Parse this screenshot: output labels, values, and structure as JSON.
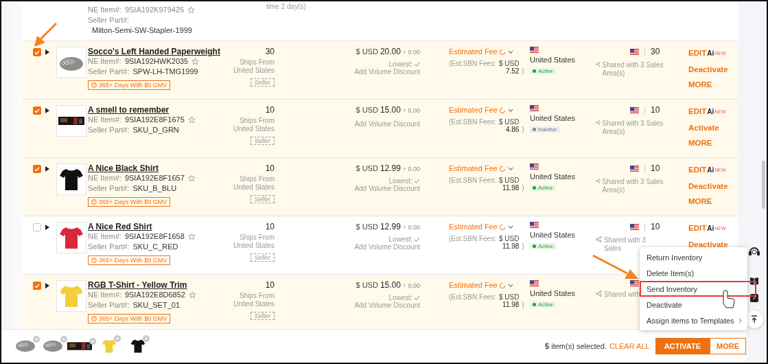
{
  "top_row": {
    "ne_label": "NE Item#:",
    "ne_item": "9SIA192K979425",
    "seller_label": "Seller Part#:",
    "seller_part": "Milton-Semi-SW-Stapler-1999",
    "note": "time 2 day(s)"
  },
  "rows": [
    {
      "selected": true,
      "title": "Socco's Left Handed Paperweight",
      "ne_label": "NE Item#:",
      "ne_item": "9SIA192HWK2035",
      "seller_label": "Seller Part#:",
      "seller_part": "SPW-LH-TMG1999",
      "gmv_badge": "365+ Days With $0 GMV",
      "qty": "30",
      "ships_from": "Ships From United States",
      "ship_tag": "Seller",
      "currency": "$ USD",
      "price": "20.00",
      "price_extra": "÷ 0.00",
      "lowest": "Lowest:",
      "volume": "Add Volume Discount",
      "fee_label": "Estimated Fee",
      "sbn_label": "(Est.SBN Fees:",
      "sbn_currency": "$ USD",
      "sbn_amount": "7.52",
      "sbn_close": ")",
      "country": "United States",
      "status": {
        "kind": "active",
        "label": "Active"
      },
      "area_qty": "30",
      "shared": "Shared with 3 Sales Area(s)",
      "actions": [
        {
          "kind": "edit",
          "label": "EDIT",
          "ai": "Ai",
          "new": "NEW"
        },
        {
          "kind": "plain",
          "label": "Deactivate"
        },
        {
          "kind": "plain",
          "label": "MORE"
        }
      ]
    },
    {
      "selected": true,
      "title": "A smell to remember",
      "ne_label": "NE Item#:",
      "ne_item": "9SIA192E8F1675",
      "seller_label": "Seller Part#:",
      "seller_part": "SKU_D_GRN",
      "qty": "10",
      "ships_from": "Ships From United States",
      "ship_tag": "Seller",
      "currency": "$ USD",
      "price": "15.00",
      "price_extra": "÷ 0.00",
      "volume": "Add Volume Discount",
      "fee_label": "Estimated Fee",
      "sbn_label": "(Est.SBN Fees:",
      "sbn_currency": "$ USD",
      "sbn_amount": "4.86",
      "sbn_close": ")",
      "country": "United States",
      "status": {
        "kind": "inactive",
        "label": "Inactive"
      },
      "area_qty": "10",
      "shared": "Shared with 3 Sales Area(s)",
      "actions": [
        {
          "kind": "edit",
          "label": "EDIT",
          "ai": "Ai",
          "new": "NEW"
        },
        {
          "kind": "plain",
          "label": "Activate"
        },
        {
          "kind": "plain",
          "label": "MORE"
        }
      ]
    },
    {
      "selected": true,
      "title": "A Nice Black Shirt",
      "ne_label": "NE Item#:",
      "ne_item": "9SIA192E8F1657",
      "seller_label": "Seller Part#:",
      "seller_part": "SKU_B_BLU",
      "gmv_badge": "365+ Days With $0 GMV",
      "qty": "10",
      "ships_from": "Ships From United States",
      "ship_tag": "Seller",
      "currency": "$ USD",
      "price": "12.99",
      "price_extra": "÷ 0.00",
      "lowest": "Lowest:",
      "volume": "Add Volume Discount",
      "fee_label": "Estimated Fee",
      "sbn_label": "(Est.SBN Fees:",
      "sbn_currency": "$ USD",
      "sbn_amount": "11.98",
      "sbn_close": ")",
      "country": "United States",
      "status": {
        "kind": "active",
        "label": "Active"
      },
      "area_qty": "10",
      "shared": "Shared with 3 Sales Area(s)",
      "actions": [
        {
          "kind": "edit",
          "label": "EDIT",
          "ai": "Ai",
          "new": "NEW"
        },
        {
          "kind": "plain",
          "label": "Deactivate"
        },
        {
          "kind": "plain",
          "label": "MORE"
        }
      ]
    },
    {
      "selected": false,
      "title": "A Nice Red Shirt",
      "ne_label": "NE Item#:",
      "ne_item": "9SIA192E8F1658",
      "seller_label": "Seller Part#:",
      "seller_part": "SKU_C_RED",
      "gmv_badge": "365+ Days With $0 GMV",
      "qty": "10",
      "ships_from": "Ships From United States",
      "ship_tag": "Seller",
      "currency": "$ USD",
      "price": "12.99",
      "price_extra": "÷ 0.00",
      "lowest": "Lowest:",
      "volume": "Add Volume Discount",
      "fee_label": "Estimated Fee",
      "sbn_label": "(Est.SBN Fees:",
      "sbn_currency": "$ USD",
      "sbn_amount": "11.98",
      "sbn_close": ")",
      "country": "United States",
      "status": {
        "kind": "active",
        "label": "Active"
      },
      "area_qty": "10",
      "shared": "Shared with 3 Sales",
      "actions": [
        {
          "kind": "edit",
          "label": "EDIT",
          "ai": "Ai",
          "new": "NEW"
        },
        {
          "kind": "plain",
          "label": "Deactivate"
        }
      ]
    },
    {
      "selected": true,
      "title": "RGB T-Shirt - Yellow Trim",
      "ne_label": "NE Item#:",
      "ne_item": "9SIA192E8D6852",
      "seller_label": "Seller Part#:",
      "seller_part": "SKU_SET_01",
      "gmv_badge": "365+ Days With $0 GMV",
      "qty": "10",
      "ships_from": "Ships From United States",
      "ship_tag": "Seller",
      "currency": "$ USD",
      "price": "15.00",
      "price_extra": "÷ 0.00",
      "lowest": "Lowest:",
      "volume": "Add Volume Discount",
      "fee_label": "Estimated Fee",
      "sbn_label": "(Est.SBN Fees:",
      "sbn_currency": "$ USD",
      "sbn_amount": "11.98",
      "sbn_close": ")",
      "country": "United States",
      "status": {
        "kind": "active",
        "label": "Active"
      },
      "shared": "Shared with",
      "actions": []
    }
  ],
  "menu": {
    "items": [
      {
        "label": "Return Inventory",
        "highlighted": false
      },
      {
        "label": "Delete Item(s)",
        "highlighted": false
      },
      {
        "label": "Send Inventory",
        "highlighted": true
      },
      {
        "label": "Deactivate",
        "highlighted": false
      },
      {
        "label": "Assign items to Templates",
        "highlighted": false,
        "submenu": true
      }
    ]
  },
  "selection_bar": {
    "count": "5",
    "count_text": "item(s) selected.",
    "clear_all": "CLEAR ALL",
    "activate": "ACTIVATE",
    "more": "MORE"
  }
}
